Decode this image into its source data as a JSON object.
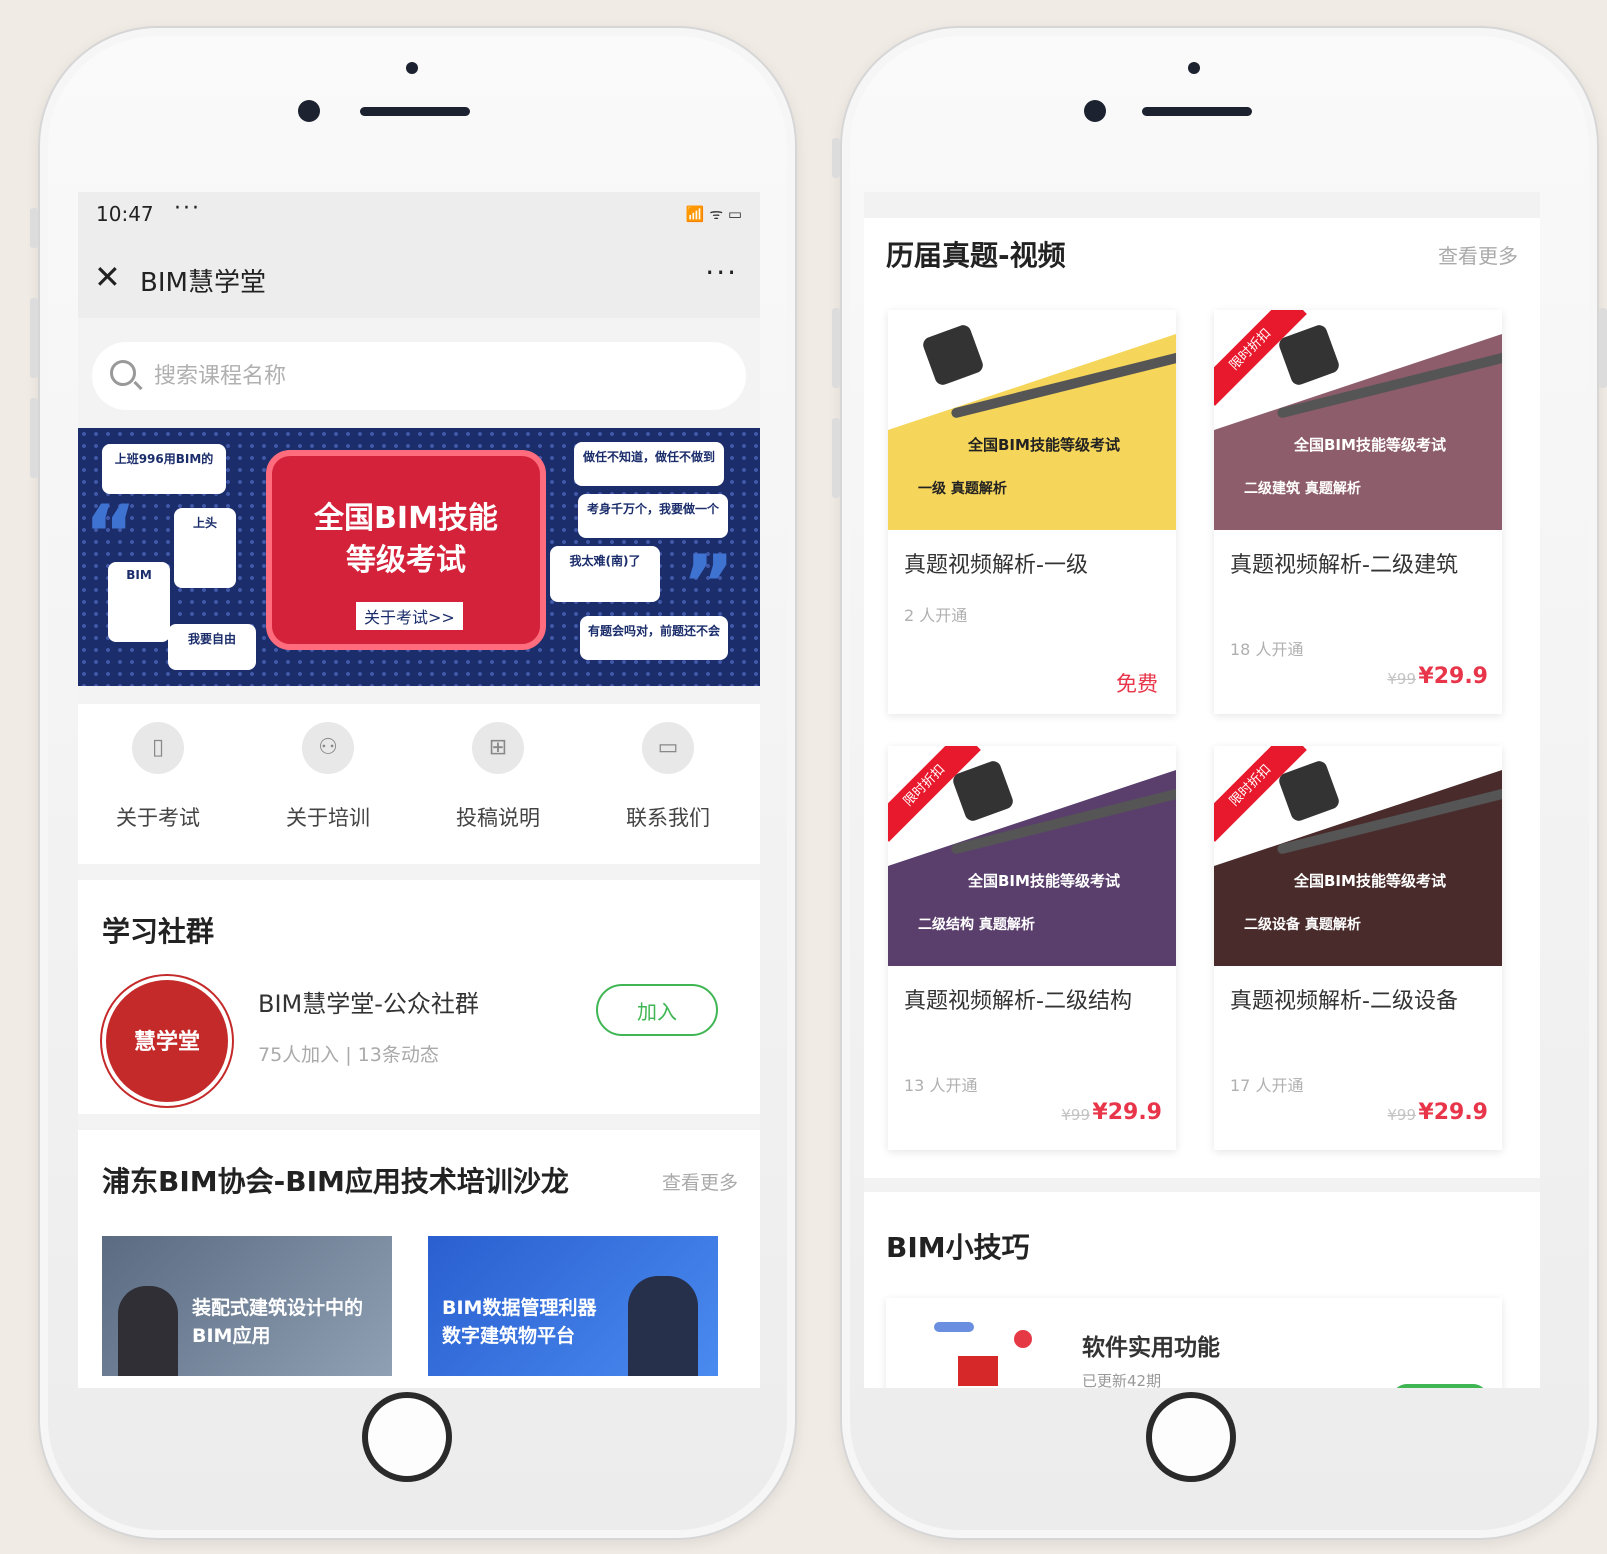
{
  "left_screen": {
    "status": {
      "time": "10:47",
      "dots": "···",
      "icons": "📶 ᯤ ▭"
    },
    "nav": {
      "close": "✕",
      "title": "BIM慧学堂",
      "menu": "···"
    },
    "search": {
      "placeholder": "搜索课程名称"
    },
    "banner": {
      "title_line1": "全国BIM技能",
      "title_line2": "等级考试",
      "link": "关于考试>>",
      "bubbles": [
        "上班996用BIM的",
        "上头",
        "BIM",
        "我要自由",
        "做任不知道，做任不做到",
        "考身千万个，我要做一个",
        "我太难(南)了",
        "有题会吗对，前题还不会"
      ]
    },
    "quick_nav": [
      {
        "label": "关于考试",
        "icon": "book-icon"
      },
      {
        "label": "关于培训",
        "icon": "people-icon"
      },
      {
        "label": "投稿说明",
        "icon": "grid-icon"
      },
      {
        "label": "联系我们",
        "icon": "monitor-icon"
      }
    ],
    "community": {
      "title": "学习社群",
      "group_name": "BIM慧学堂-公众社群",
      "stats": "75人加入 | 13条动态",
      "avatar_text": "慧学堂",
      "join_label": "加入"
    },
    "salon": {
      "title": "浦东BIM协会-BIM应用技术培训沙龙",
      "more": "查看更多",
      "items": [
        {
          "text": "装配式建筑设计中的BIM应用"
        },
        {
          "text": "BIM数据管理利器数字建筑物平台"
        }
      ]
    }
  },
  "right_screen": {
    "videos": {
      "title": "历届真题-视频",
      "more": "查看更多",
      "courses": [
        {
          "title": "真题视频解析-一级",
          "students": "2 人开通",
          "free": "免费",
          "thumb_title": "全国BIM技能等级考试",
          "thumb_sub": "一级 真题解析",
          "color": "#f5d55a"
        },
        {
          "title": "真题视频解析-二级建筑",
          "students": "18 人开通",
          "old_price": "¥99",
          "price": "¥29.9",
          "ribbon": "限时折扣",
          "thumb_title": "全国BIM技能等级考试",
          "thumb_sub": "二级建筑 真题解析",
          "color": "#8e5d6c"
        },
        {
          "title": "真题视频解析-二级结构",
          "students": "13 人开通",
          "old_price": "¥99",
          "price": "¥29.9",
          "ribbon": "限时折扣",
          "thumb_title": "全国BIM技能等级考试",
          "thumb_sub": "二级结构 真题解析",
          "color": "#5a3f6d"
        },
        {
          "title": "真题视频解析-二级设备",
          "students": "17 人开通",
          "old_price": "¥99",
          "price": "¥29.9",
          "ribbon": "限时折扣",
          "thumb_title": "全国BIM技能等级考试",
          "thumb_sub": "二级设备 真题解析",
          "color": "#4a2b2b"
        }
      ]
    },
    "tips": {
      "title": "BIM小技巧",
      "item_name": "软件实用功能",
      "item_sub": "已更新42期"
    }
  }
}
